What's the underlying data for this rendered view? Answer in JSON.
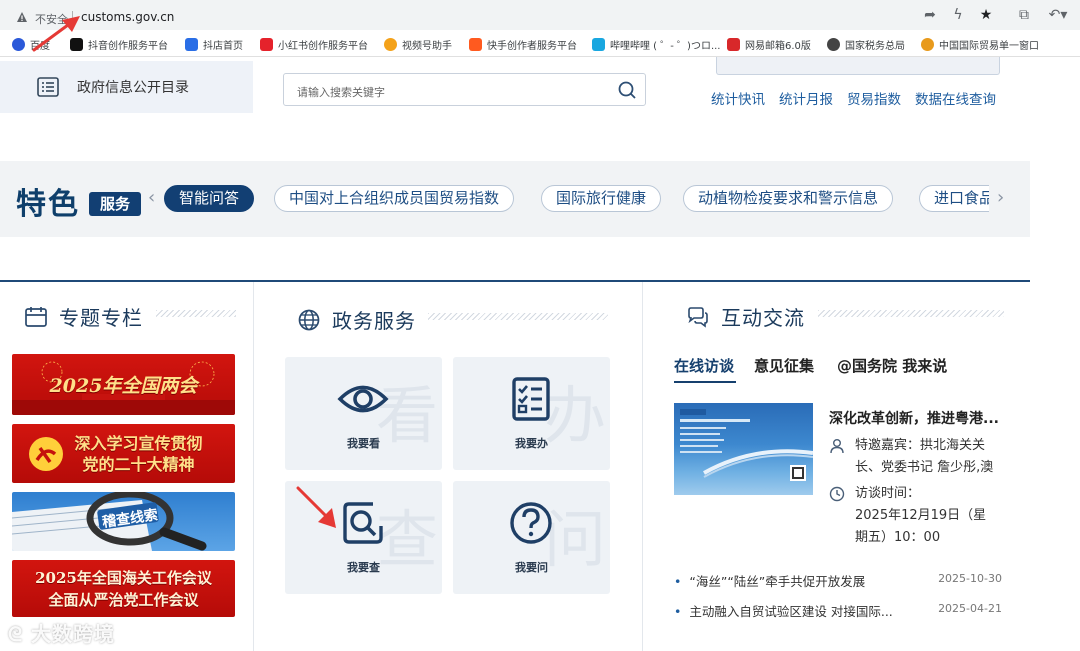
{
  "browser": {
    "not_secure": "不安全",
    "url": "customs.gov.cn",
    "bookmarks": [
      {
        "label": "百度",
        "color": "#2b59d9"
      },
      {
        "label": "抖音创作服务平台",
        "color": "#111111"
      },
      {
        "label": "抖店首页",
        "color": "#2a6ee6"
      },
      {
        "label": "小红书创作服务平台",
        "color": "#e5222b"
      },
      {
        "label": "视频号助手",
        "color": "#f4a21a"
      },
      {
        "label": "快手创作者服务平台",
        "color": "#ff5a1f"
      },
      {
        "label": "哔哩哔哩 ( ゜- ゜)つロ...",
        "color": "#19a7e0"
      },
      {
        "label": "网易邮箱6.0版",
        "color": "#d8282a"
      },
      {
        "label": "国家税务总局",
        "color": "#444444"
      },
      {
        "label": "中国国际贸易单一窗口",
        "color": "#e89a1c"
      }
    ]
  },
  "header": {
    "gov_dir": "政府信息公开目录",
    "search_placeholder": "请输入搜索关键字",
    "stat_links": [
      "统计快讯",
      "统计月报",
      "贸易指数",
      "数据在线查询"
    ]
  },
  "feature": {
    "title": "特色",
    "badge": "服务",
    "tags": [
      "智能问答",
      "中国对上合组织成员国贸易指数",
      "国际旅行健康",
      "动植物检疫要求和警示信息",
      "进口食品"
    ]
  },
  "special": {
    "title": "专题专栏",
    "banners": [
      {
        "text": "2025年全国两会"
      },
      {
        "text": "深入学习宣传贯彻\n党的二十大精神"
      },
      {
        "text": "稽查线索"
      },
      {
        "text": "2025年全国海关工作会议\n全面从严治党工作会议"
      }
    ]
  },
  "services": {
    "title": "政务服务",
    "items": [
      {
        "label": "我要看",
        "ghost": "看"
      },
      {
        "label": "我要办",
        "ghost": "办"
      },
      {
        "label": "我要查",
        "ghost": "查"
      },
      {
        "label": "我要问",
        "ghost": "问"
      }
    ]
  },
  "interact": {
    "title": "互动交流",
    "tabs": [
      "在线访谈",
      "意见征集",
      "@国务院 我来说"
    ],
    "news_title": "深化改革创新，推进粤港...",
    "guest_line1": "特邀嘉宾：拱北海关关",
    "guest_line2": "长、党委书记 詹少彤,澳",
    "time_line1": "访谈时间：",
    "time_line2": "2025年12月19日（星",
    "time_line3": "期五）10：00",
    "list": [
      {
        "text": "“海丝”“陆丝”牵手共促开放发展",
        "date": "2025-10-30"
      },
      {
        "text": "主动融入自贸试验区建设 对接国际...",
        "date": "2025-04-21"
      }
    ]
  },
  "watermark": "大数跨境"
}
